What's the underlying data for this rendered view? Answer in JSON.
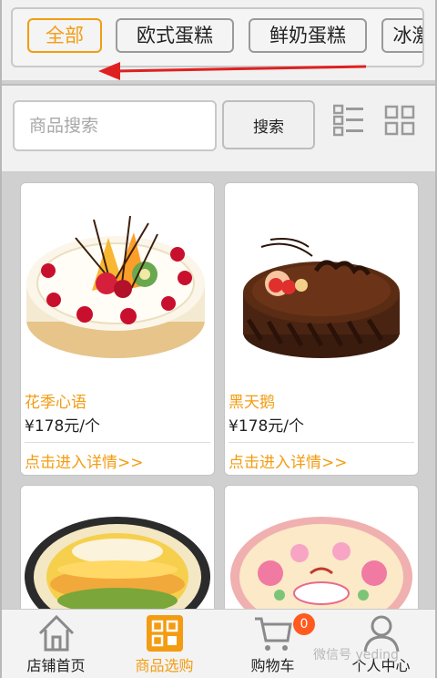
{
  "categories": [
    "全部",
    "欧式蛋糕",
    "鲜奶蛋糕",
    "冰激凌蛋糕"
  ],
  "search": {
    "placeholder": "商品搜索",
    "button_label": "搜索"
  },
  "products": [
    {
      "name": "花季心语",
      "price": "¥178元/个",
      "link": "点击进入详情>>"
    },
    {
      "name": "黑天鹅",
      "price": "¥178元/个",
      "link": "点击进入详情>>"
    },
    {
      "name": "",
      "price": "",
      "link": ""
    },
    {
      "name": "",
      "price": "",
      "link": ""
    }
  ],
  "nav": [
    {
      "label": "店铺首页",
      "icon": "home-icon"
    },
    {
      "label": "商品选购",
      "icon": "shop-grid-icon"
    },
    {
      "label": "购物车",
      "icon": "cart-icon",
      "badge": "0"
    },
    {
      "label": "个人中心",
      "icon": "user-icon"
    }
  ],
  "watermark": "微信号 yeding",
  "colors": {
    "accent": "#f39c12",
    "badge": "#ff5a1f",
    "arrow": "#e02020"
  }
}
